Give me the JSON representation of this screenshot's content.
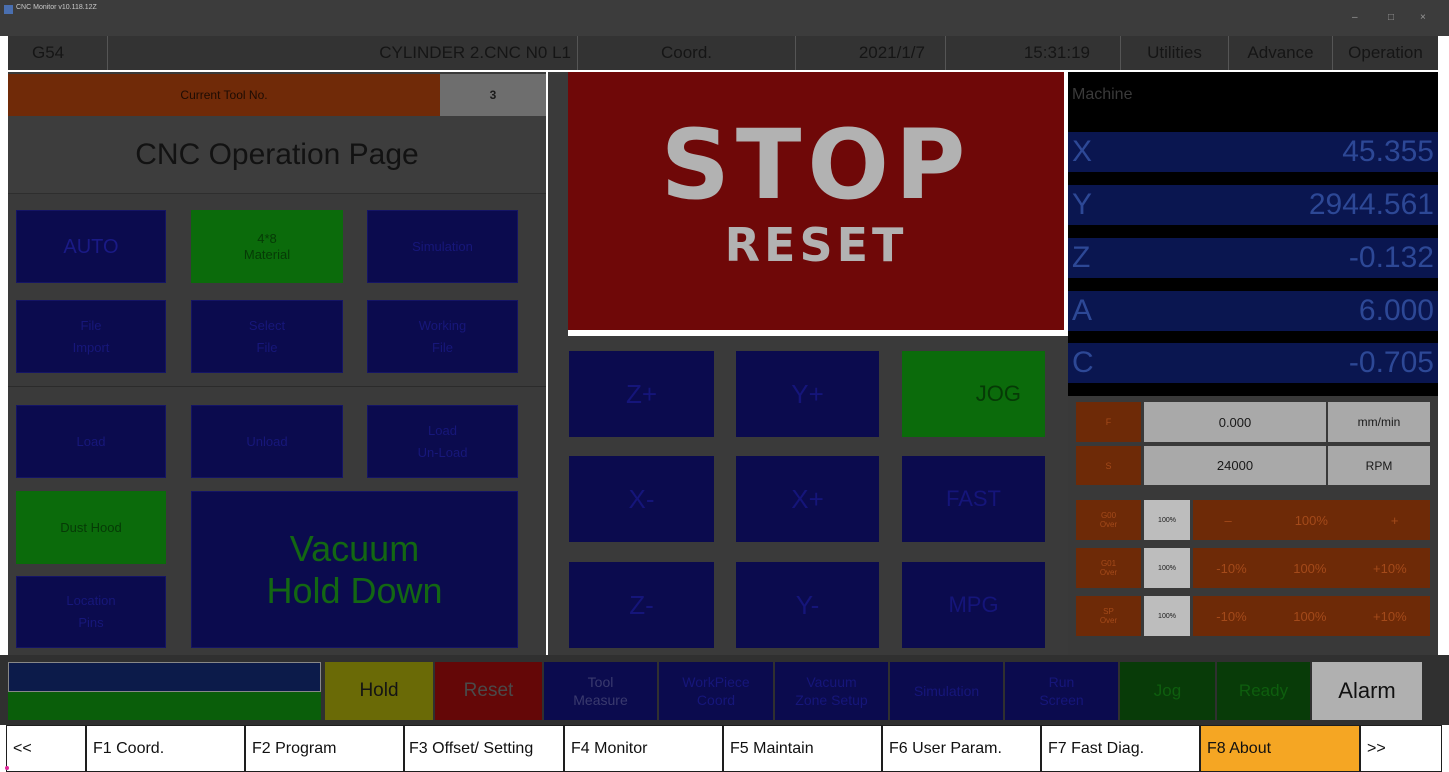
{
  "window": {
    "title": "CNC Monitor v10.118.12Z",
    "minimize": "–",
    "maximize": "□",
    "close": "×"
  },
  "header": {
    "coord_system": "G54",
    "program": "CYLINDER 2.CNC N0 L1",
    "coord": "Coord.",
    "date": "2021/1/7",
    "time": "15:31:19",
    "utilities": "Utilities",
    "advance": "Advance",
    "operation": "Operation"
  },
  "tool": {
    "label": "Current Tool No.",
    "value": "3"
  },
  "page_title": "CNC Operation Page",
  "buttons": {
    "auto": "AUTO",
    "material_1": "4*8",
    "material_2": "Material",
    "simulation": "Simulation",
    "file_import_1": "File",
    "file_import_2": "Import",
    "select_file_1": "Select",
    "select_file_2": "File",
    "working_file_1": "Working",
    "working_file_2": "File",
    "load": "Load",
    "unload": "Unload",
    "load_unload_1": "Load",
    "load_unload_2": "Un-Load",
    "dust_hood": "Dust Hood",
    "vacuum_1": "Vacuum",
    "vacuum_2": "Hold Down",
    "location_pins_1": "Location",
    "location_pins_2": "Pins"
  },
  "stop": {
    "stop": "STOP",
    "reset": "RESET"
  },
  "jog": {
    "z_plus": "Z+",
    "y_plus": "Y+",
    "jog": "JOG",
    "x_minus": "X-",
    "x_plus": "X+",
    "fast": "FAST",
    "z_minus": "Z-",
    "y_minus": "Y-",
    "mpg": "MPG"
  },
  "machine": {
    "label": "Machine",
    "axes": [
      {
        "axis": "X",
        "value": "45.355"
      },
      {
        "axis": "Y",
        "value": "2944.561"
      },
      {
        "axis": "Z",
        "value": "-0.132"
      },
      {
        "axis": "A",
        "value": "6.000"
      },
      {
        "axis": "C",
        "value": "-0.705"
      }
    ]
  },
  "feed": {
    "f_label": "F",
    "f_value": "0.000",
    "f_unit": "mm/min",
    "s_label": "S",
    "s_value": "24000",
    "s_unit": "RPM"
  },
  "overrides": [
    {
      "l1": "G00",
      "l2": "Over",
      "pct": "100%",
      "dec": "–",
      "mid": "100%",
      "inc": "+"
    },
    {
      "l1": "G01",
      "l2": "Over",
      "pct": "100%",
      "dec": "-10%",
      "mid": "100%",
      "inc": "+10%"
    },
    {
      "l1": "SP",
      "l2": "Over",
      "pct": "100%",
      "dec": "-10%",
      "mid": "100%",
      "inc": "+10%"
    }
  ],
  "bottom": {
    "hold": "Hold",
    "reset": "Reset",
    "tool_measure_1": "Tool",
    "tool_measure_2": "Measure",
    "workpiece_1": "WorkPiece",
    "workpiece_2": "Coord",
    "vacuum_1": "Vacuum",
    "vacuum_2": "Zone Setup",
    "simulation": "Simulation",
    "run_1": "Run",
    "run_2": "Screen",
    "jog": "Jog",
    "ready": "Ready",
    "alarm": "Alarm"
  },
  "function_keys": {
    "prev": "<<",
    "f1": "F1 Coord.",
    "f2": "F2 Program",
    "f3": "F3 Offset/ Setting",
    "f4": "F4 Monitor",
    "f5": "F5 Maintain",
    "f6": "F6 User Param.",
    "f7": "F7 Fast Diag.",
    "f8": "F8 About",
    "next": ">>"
  },
  "colors": {
    "stop_bg": "#6f0808",
    "active_fn": "#f5a623",
    "auto_green": "#0b6b0b",
    "nav_blue": "#0b0b4e"
  }
}
